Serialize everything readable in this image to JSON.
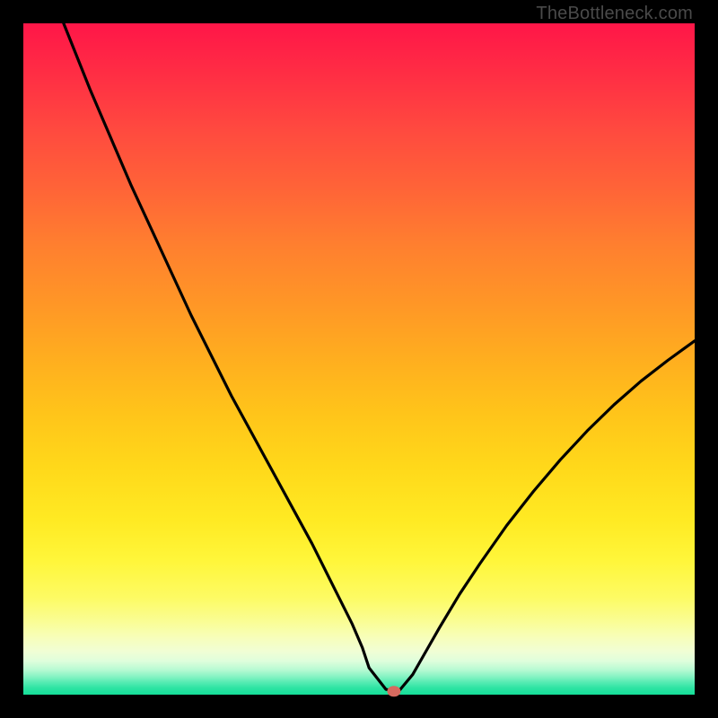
{
  "attribution": "TheBottleneck.com",
  "chart_data": {
    "type": "line",
    "title": "",
    "xlabel": "",
    "ylabel": "",
    "xlim": [
      0,
      100
    ],
    "ylim": [
      0,
      100
    ],
    "grid": false,
    "legend": false,
    "series": [
      {
        "name": "curve",
        "x": [
          6,
          8,
          10,
          13,
          16,
          19,
          22,
          25,
          28,
          31,
          34,
          37,
          40,
          43,
          45,
          47,
          49,
          50.5,
          51.5,
          54,
          55,
          56,
          58,
          60,
          62,
          65,
          68,
          72,
          76,
          80,
          84,
          88,
          92,
          96,
          100
        ],
        "y": [
          100,
          95,
          90,
          83,
          76,
          69.5,
          63,
          56.5,
          50.5,
          44.5,
          39,
          33.5,
          28,
          22.5,
          18.5,
          14.5,
          10.5,
          7,
          4,
          0.8,
          0.6,
          0.6,
          3,
          6.5,
          10,
          15,
          19.5,
          25.2,
          30.3,
          35,
          39.3,
          43.2,
          46.7,
          49.8,
          52.7
        ]
      }
    ],
    "marker": {
      "x": 55.2,
      "y": 0.5,
      "color": "#d66a5f"
    },
    "gradient_stops": [
      {
        "pos": 0,
        "color": "#ff1648"
      },
      {
        "pos": 0.5,
        "color": "#ffae1f"
      },
      {
        "pos": 0.85,
        "color": "#fdfb63"
      },
      {
        "pos": 1.0,
        "color": "#14df98"
      }
    ]
  }
}
